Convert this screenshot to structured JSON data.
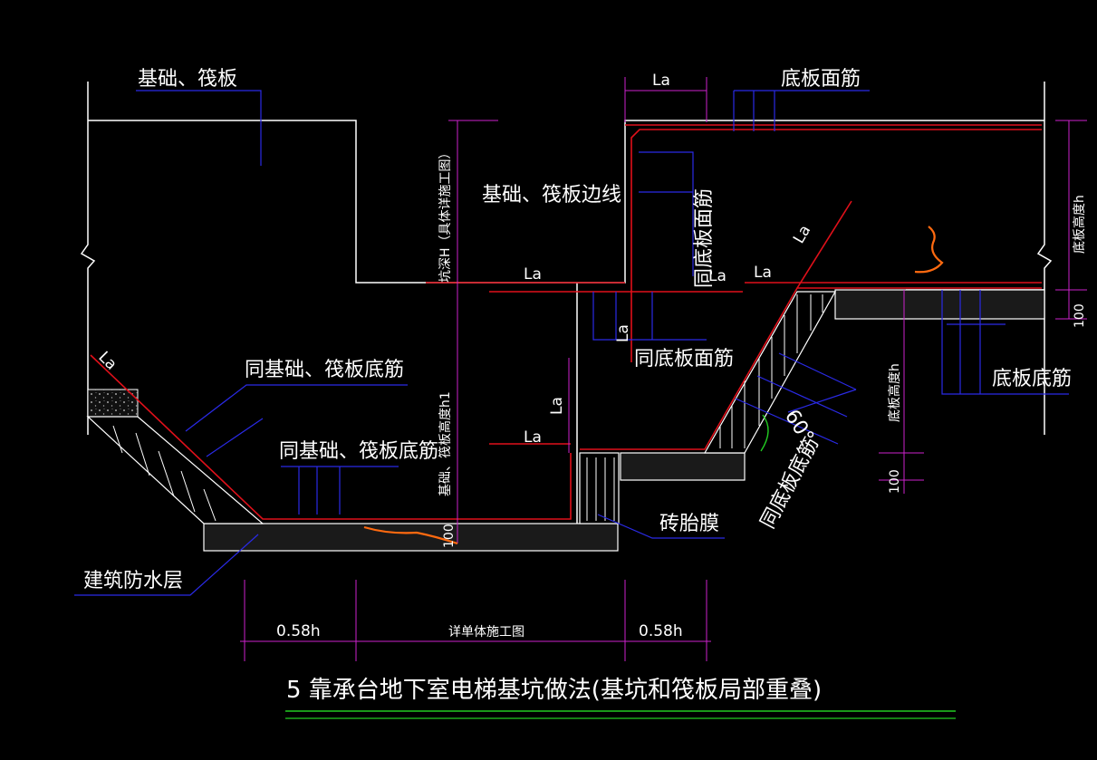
{
  "labels": {
    "foundation_raft": "基础、筏板",
    "bottom_face_rebar": "底板面筋",
    "la": "La",
    "raft_edge_line": "基础、筏板边线",
    "pit_depth_note": "坑深H（具体详施工图）",
    "same_bottom_face_rebar": "同底板面筋",
    "same_foundation_bottom_rebar": "同基础、筏板底筋",
    "foundation_height_h1": "基础、筏板高度h1",
    "bottom_slab_height_h": "底板高度h",
    "hundred": "100",
    "bottom_slab_rebar": "底板底筋",
    "angle_60": "60°",
    "same_bottom_slab_rebar": "同底板底筋",
    "brick_formwork": "砖胎膜",
    "waterproof_layer": "建筑防水层",
    "dim_058h": "0.58h",
    "dim_see_detail": "详单体施工图"
  },
  "caption": "5  靠承台地下室电梯基坑做法(基坑和筏板局部重叠)",
  "colors": {
    "background": "#000000",
    "outline": "#ffffff",
    "rebar": "#e0101a",
    "leader": "#2a2ae6",
    "caption_rule": "#22cc22",
    "annotation_mark": "#ff6a10"
  }
}
